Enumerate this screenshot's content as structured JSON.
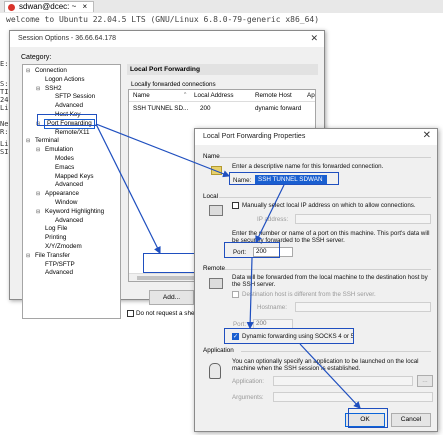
{
  "terminal": {
    "tab_title": "sdwan@dcec: ~",
    "tab_close": "×",
    "welcome": "welcome to Ubuntu 22.04.5 LTS (GNU/Linux 6.8.0-79-generic x86_64)",
    "side_fragments": [
      "E:",
      "S:",
      "TI",
      "24",
      "Li",
      "Ne",
      "R:",
      "Li",
      "SI"
    ]
  },
  "session": {
    "title": "Session Options - 36.66.64.178",
    "close": "✕",
    "category_label": "Category:",
    "tree": [
      {
        "label": "Connection",
        "indent": 0,
        "expander": "⊟"
      },
      {
        "label": "Logon Actions",
        "indent": 1
      },
      {
        "label": "SSH2",
        "indent": 1,
        "expander": "⊟"
      },
      {
        "label": "SFTP Session",
        "indent": 2
      },
      {
        "label": "Advanced",
        "indent": 2
      },
      {
        "label": "Host Key",
        "indent": 2
      },
      {
        "label": "Port Forwarding",
        "indent": 1,
        "expander": "⊟"
      },
      {
        "label": "Remote/X11",
        "indent": 2
      },
      {
        "label": "Terminal",
        "indent": 0,
        "expander": "⊟"
      },
      {
        "label": "Emulation",
        "indent": 1,
        "expander": "⊟"
      },
      {
        "label": "Modes",
        "indent": 2
      },
      {
        "label": "Emacs",
        "indent": 2
      },
      {
        "label": "Mapped Keys",
        "indent": 2
      },
      {
        "label": "Advanced",
        "indent": 2
      },
      {
        "label": "Appearance",
        "indent": 1,
        "expander": "⊟"
      },
      {
        "label": "Window",
        "indent": 2
      },
      {
        "label": "Keyword Highlighting",
        "indent": 1,
        "expander": "⊟"
      },
      {
        "label": "Advanced",
        "indent": 2
      },
      {
        "label": "Log File",
        "indent": 1
      },
      {
        "label": "Printing",
        "indent": 1
      },
      {
        "label": "X/Y/Zmodem",
        "indent": 1
      },
      {
        "label": "File Transfer",
        "indent": 0,
        "expander": "⊟"
      },
      {
        "label": "FTP/SFTP",
        "indent": 1
      },
      {
        "label": "Advanced",
        "indent": 1
      }
    ],
    "panel_title": "Local Port Forwarding",
    "list_label": "Locally forwarded connections",
    "columns": [
      "Name",
      "Local Address",
      "Remote Host",
      "Ap"
    ],
    "sort_indicator": "^",
    "row": [
      "SSH TUNNEL SD...",
      "200",
      "dynamic forward",
      ""
    ],
    "add_button": "Add...",
    "no_shell_label": "Do not request a shell"
  },
  "lpf": {
    "title": "Local Port Forwarding Properties",
    "close": "✕",
    "name_section": "Name",
    "name_desc": "Enter a descriptive name for this forwarded connection.",
    "name_label": "Name:",
    "name_value": "SSH TUNNEL SDWAN",
    "local_section": "Local",
    "manual_local_ip": "Manually select local IP address on which to allow connections.",
    "ip_address_label": "IP address:",
    "port_desc": "Enter the number or name of a port on this machine.  This port's data will be securely forwarded to the SSH server.",
    "port_label": "Port:",
    "port_value": "200",
    "remote_section": "Remote",
    "remote_desc": "Data will be forwarded from the local machine to the destination host by the SSH server.",
    "dest_differs": "Destination host is different from the SSH server.",
    "hostname_label": "Hostname:",
    "remote_port_label": "Port:",
    "remote_port_value": "200",
    "socks_label": "Dynamic forwarding using SOCKS 4 or 5",
    "socks_checked": true,
    "application_section": "Application",
    "app_desc": "You can optionally specify an application to be launched on the local machine when the SSH session is established.",
    "application_label": "Application:",
    "arguments_label": "Arguments:",
    "ellipsis": "...",
    "ok": "OK",
    "cancel": "Cancel"
  },
  "colors": {
    "highlight": "#1f4fbf",
    "selection": "#1a5fd0"
  }
}
